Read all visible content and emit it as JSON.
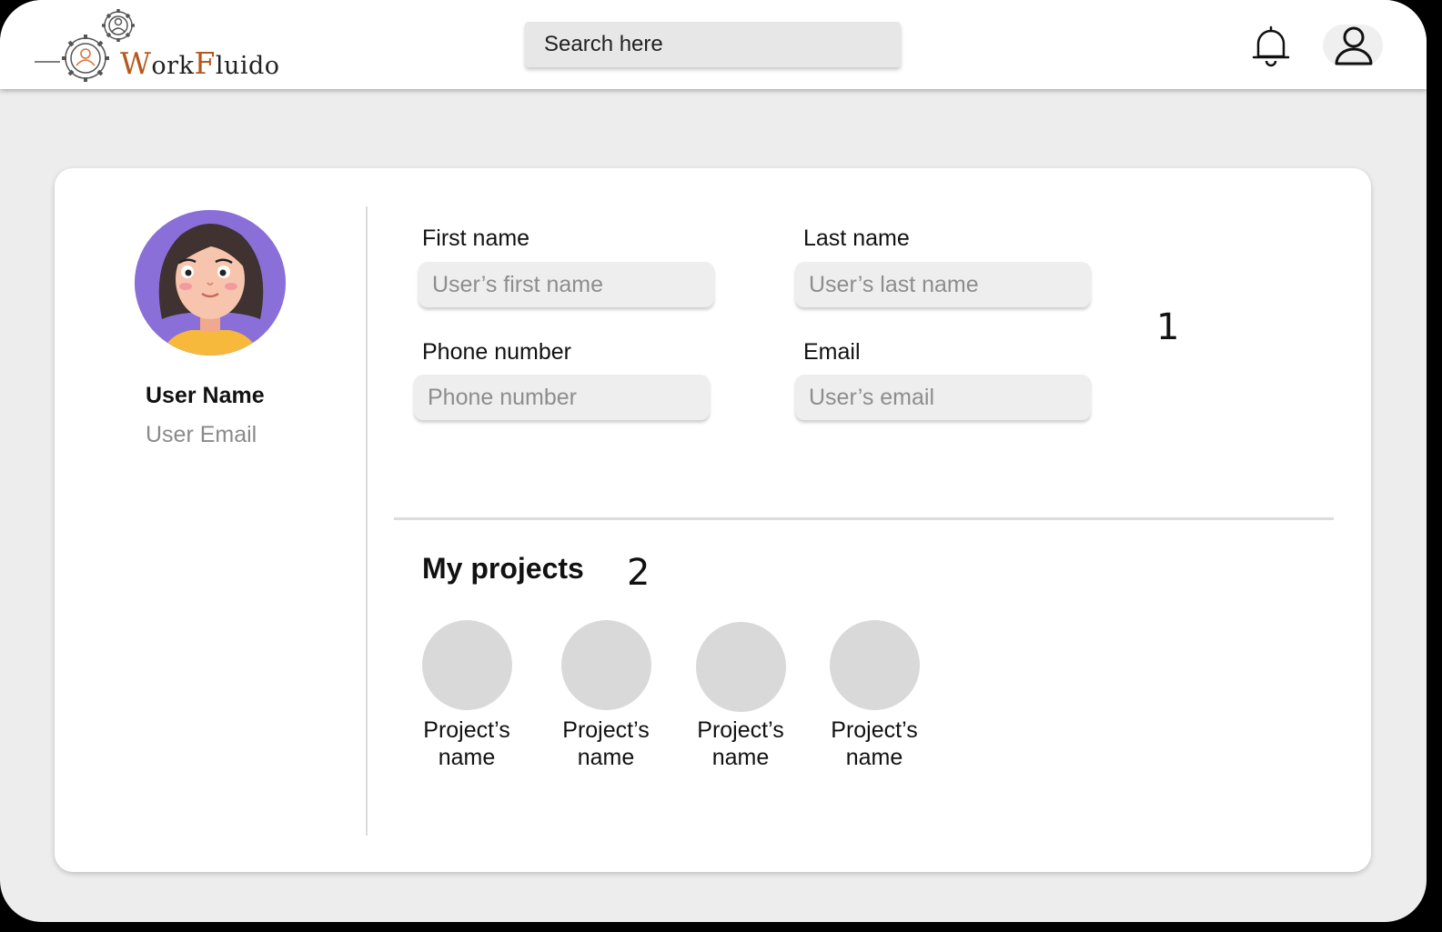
{
  "header": {
    "logo_cap_w": "W",
    "logo_rest_1": "ork",
    "logo_cap_f": "F",
    "logo_rest_2": "luido",
    "search_placeholder": "Search here",
    "bell_icon": "bell-icon",
    "profile_icon": "user-icon"
  },
  "profile": {
    "name": "User Name",
    "email": "User Email"
  },
  "form": {
    "first_name_label": "First name",
    "first_name_placeholder": "User’s first name",
    "last_name_label": "Last name",
    "last_name_placeholder": "User’s last name",
    "phone_label": "Phone number",
    "phone_placeholder": "Phone number",
    "email_label": "Email",
    "email_placeholder": "User’s email",
    "marker": "1"
  },
  "projects": {
    "title": "My projects",
    "marker": "2",
    "items": [
      {
        "line1": "Project’s",
        "line2": "name"
      },
      {
        "line1": "Project’s",
        "line2": "name"
      },
      {
        "line1": "Project’s",
        "line2": "name"
      },
      {
        "line1": "Project’s",
        "line2": "name"
      }
    ]
  },
  "colors": {
    "accent": "#b5581c",
    "avatar_bg": "#8a6fd8",
    "background": "#ededed"
  }
}
